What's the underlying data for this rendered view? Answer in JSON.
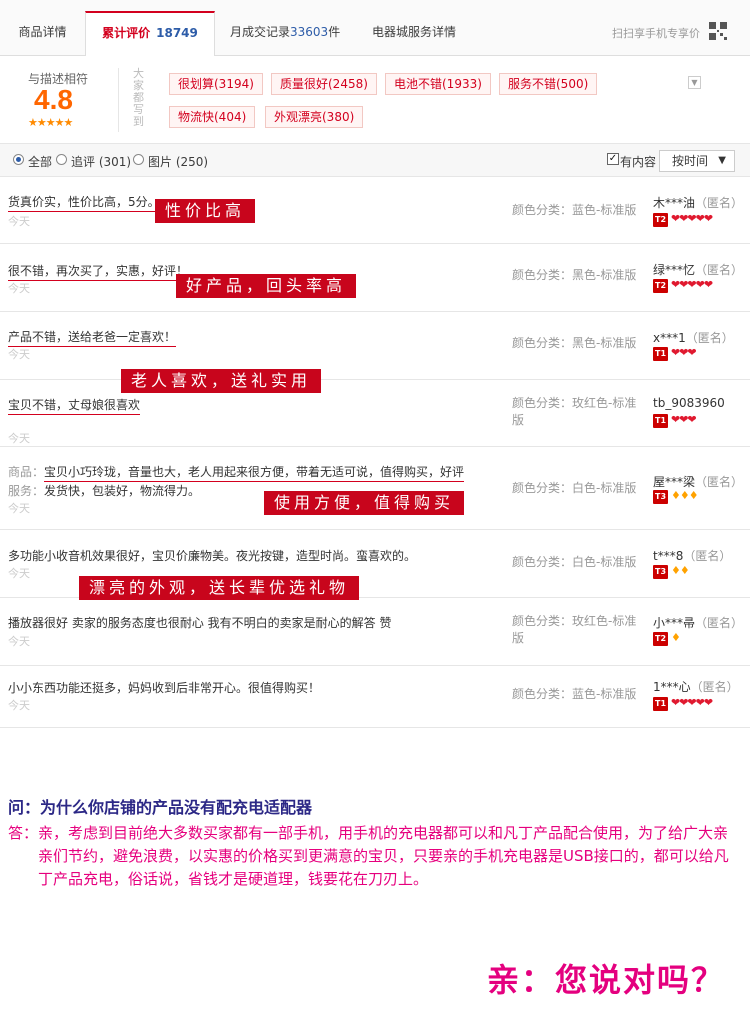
{
  "tabs": [
    {
      "label": "商品详情"
    },
    {
      "label": "累计评价",
      "count": "18749"
    },
    {
      "label": "月成交记录",
      "count": "33603",
      "suffix": "件"
    },
    {
      "label": "电器城服务详情"
    }
  ],
  "qr_text": "扫扫享手机专享价",
  "summary": {
    "label": "与描述相符",
    "score": "4.8",
    "stars": "★★★★★",
    "vertical_label": "大家都写到",
    "tags": [
      "很划算(3194)",
      "质量很好(2458)",
      "电池不错(1933)",
      "服务不错(500)",
      "物流快(404)",
      "外观漂亮(380)"
    ]
  },
  "filter": {
    "all": "全部",
    "append": "追评 (301)",
    "pics": "图片 (250)",
    "has_content": "有内容",
    "sort": "按时间"
  },
  "reviews": [
    {
      "text": "货真价实，性价比高，5分。",
      "date": "今天",
      "color": "颜色分类：蓝色-标准版",
      "user": "木***油",
      "anon": "（匿名）",
      "badge": "T2",
      "hearts": "❤❤❤❤❤",
      "banner": "性价比高"
    },
    {
      "text": "很不错，再次买了，实惠，好评！",
      "date": "今天",
      "color": "颜色分类：黑色-标准版",
      "user": "绿***忆",
      "anon": "（匿名）",
      "badge": "T2",
      "hearts": "❤❤❤❤❤",
      "banner": "好产品，回头率高"
    },
    {
      "text": "产品不错，送给老爸一定喜欢！",
      "date": "今天",
      "color": "颜色分类：黑色-标准版",
      "user": "x***1",
      "anon": "（匿名）",
      "badge": "T1",
      "hearts": "❤❤❤",
      "banner": "老人喜欢，送礼实用"
    },
    {
      "text": "宝贝不错，丈母娘很喜欢",
      "date": "今天",
      "color": "颜色分类：玫红色-标准版",
      "user": "tb_9083960",
      "anon": "",
      "badge": "T1",
      "hearts": "❤❤❤"
    },
    {
      "text_label": "商品：",
      "text": "宝贝小巧玲珑，音量也大，老人用起来很方便，带着无适可说，值得购买，好评",
      "sub_label": "服务：",
      "sub": "发货快，包装好，物流得力。",
      "date": "今天",
      "color": "颜色分类：白色-标准版",
      "user": "屋***梁",
      "anon": "（匿名）",
      "badge": "T3",
      "hearts": "♦♦♦",
      "banner": "使用方便，值得购买"
    },
    {
      "text": "多功能小收音机效果很好，宝贝价廉物美。夜光按键，造型时尚。蛮喜欢的。",
      "date": "今天",
      "color": "颜色分类：白色-标准版",
      "user": "t***8",
      "anon": "（匿名）",
      "badge": "T3",
      "hearts": "♦♦",
      "banner": "漂亮的外观，送长辈优选礼物"
    },
    {
      "text": "播放器很好 卖家的服务态度也很耐心 我有不明白的卖家是耐心的解答 赞",
      "date": "今天",
      "color": "颜色分类：玫红色-标准版",
      "user": "小***帚",
      "anon": "（匿名）",
      "badge": "T2",
      "hearts": "♦"
    },
    {
      "text": "小小东西功能还挺多，妈妈收到后非常开心。很值得购买！",
      "date": "今天",
      "color": "颜色分类：蓝色-标准版",
      "user": "1***心",
      "anon": "（匿名）",
      "badge": "T1",
      "hearts": "❤❤❤❤❤"
    }
  ],
  "qa": {
    "question": "问：为什么你店铺的产品没有配充电适配器",
    "answer_label": "答：",
    "answer": "亲，考虑到目前绝大多数买家都有一部手机，用手机的充电器都可以和凡丁产品配合使用，为了给广大亲亲们节约，避免浪费，以实惠的价格买到更满意的宝贝，只要亲的手机充电器是USB接口的，都可以给凡丁产品充电，俗话说，省钱才是硬道理，钱要花在刀刃上。",
    "closing": "亲：您说对吗？"
  },
  "colors": {
    "accent_red": "#d3001e",
    "banner_red": "#c8051c",
    "score_orange": "#ff6600",
    "question_navy": "#2c2886",
    "answer_magenta": "#e6007e"
  }
}
